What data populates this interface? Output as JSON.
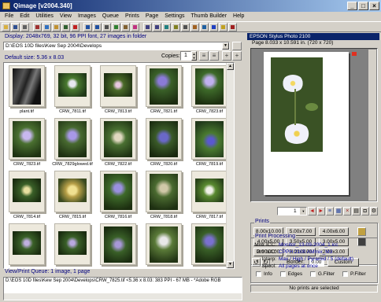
{
  "window": {
    "title": "Qimage [v2004.340]",
    "buttons": [
      "_",
      "□",
      "×"
    ]
  },
  "menu": [
    "File",
    "Edit",
    "Utilities",
    "View",
    "Images",
    "Queue",
    "Prints",
    "Page",
    "Settings",
    "Thumb Builder",
    "Help"
  ],
  "browser": {
    "display_info": "Display: 2048x769, 32 bit, 96 PPI font, 27 images in folder",
    "path": "D:\\EOS 10D files\\Kew Sep 2004\\Develops",
    "default_size": "Default size: 5.36 x 8.03",
    "copies_label": "Copies:",
    "copies_value": "1",
    "thumbnails": [
      {
        "name": "plant.tif"
      },
      {
        "name": "CRW_7811.tif"
      },
      {
        "name": "CRW_7813.tif"
      },
      {
        "name": "CRW_7821.tif"
      },
      {
        "name": "CRW_7823.tif"
      },
      {
        "name": "CRW_7823.tif"
      },
      {
        "name": "CRW_7829glowed.tif"
      },
      {
        "name": "CRW_7822.tif"
      },
      {
        "name": "CRW_7820.tif"
      },
      {
        "name": "CRW_7819.tif"
      },
      {
        "name": "CRW_7814.tif"
      },
      {
        "name": "CRW_7815.tif"
      },
      {
        "name": "CRW_7816.tif"
      },
      {
        "name": "CRW_7818.tif"
      },
      {
        "name": "CRW_7817.tif"
      },
      {
        "name": ""
      },
      {
        "name": ""
      },
      {
        "name": ""
      },
      {
        "name": ""
      },
      {
        "name": ""
      }
    ],
    "view_info": "View/Print Queue: 1 image, 1 page",
    "file_info": "D:\\EOS 10D files\\Kew Sep 2004\\Develops\\CRW_7825.tif <5.36 x 8.03: 383 PPI - 67 MB - *Adobe RGB"
  },
  "printer": {
    "name": "EPSON Stylus Photo 2100",
    "page_size": "Page  8.033 x 10.591 in. (720 x 720)",
    "page_select": "1",
    "prints_label": "Prints",
    "print_sizes": [
      "8.00x10.00",
      "5.00x7.00",
      "4.00x6.00",
      "4.00x5.00",
      "3.50x5.00",
      "3.00x5.00",
      "3:00x4.00",
      "3.00x3.00",
      "2.00x3.00"
    ],
    "border_label": "Border:",
    "border_value": "0.00",
    "custom_label": "Custom",
    "processing_label": "Print Processing",
    "processing": [
      {
        "key": "Mntr ICC:",
        "value": "Monitor_13-09-2004_1.icc"
      },
      {
        "key": "Prtr ICC:",
        "value": "CPPH 2100 AMmix_M3"
      },
      {
        "key": "Interp:",
        "value": "Max / High / Pyramid / 5 (default)"
      },
      {
        "key": "Spool:",
        "value": "All pages at once"
      }
    ],
    "options": [
      "Info",
      "Edges",
      "G.Filter",
      "P.Filter"
    ],
    "status": "No prints are selected"
  }
}
